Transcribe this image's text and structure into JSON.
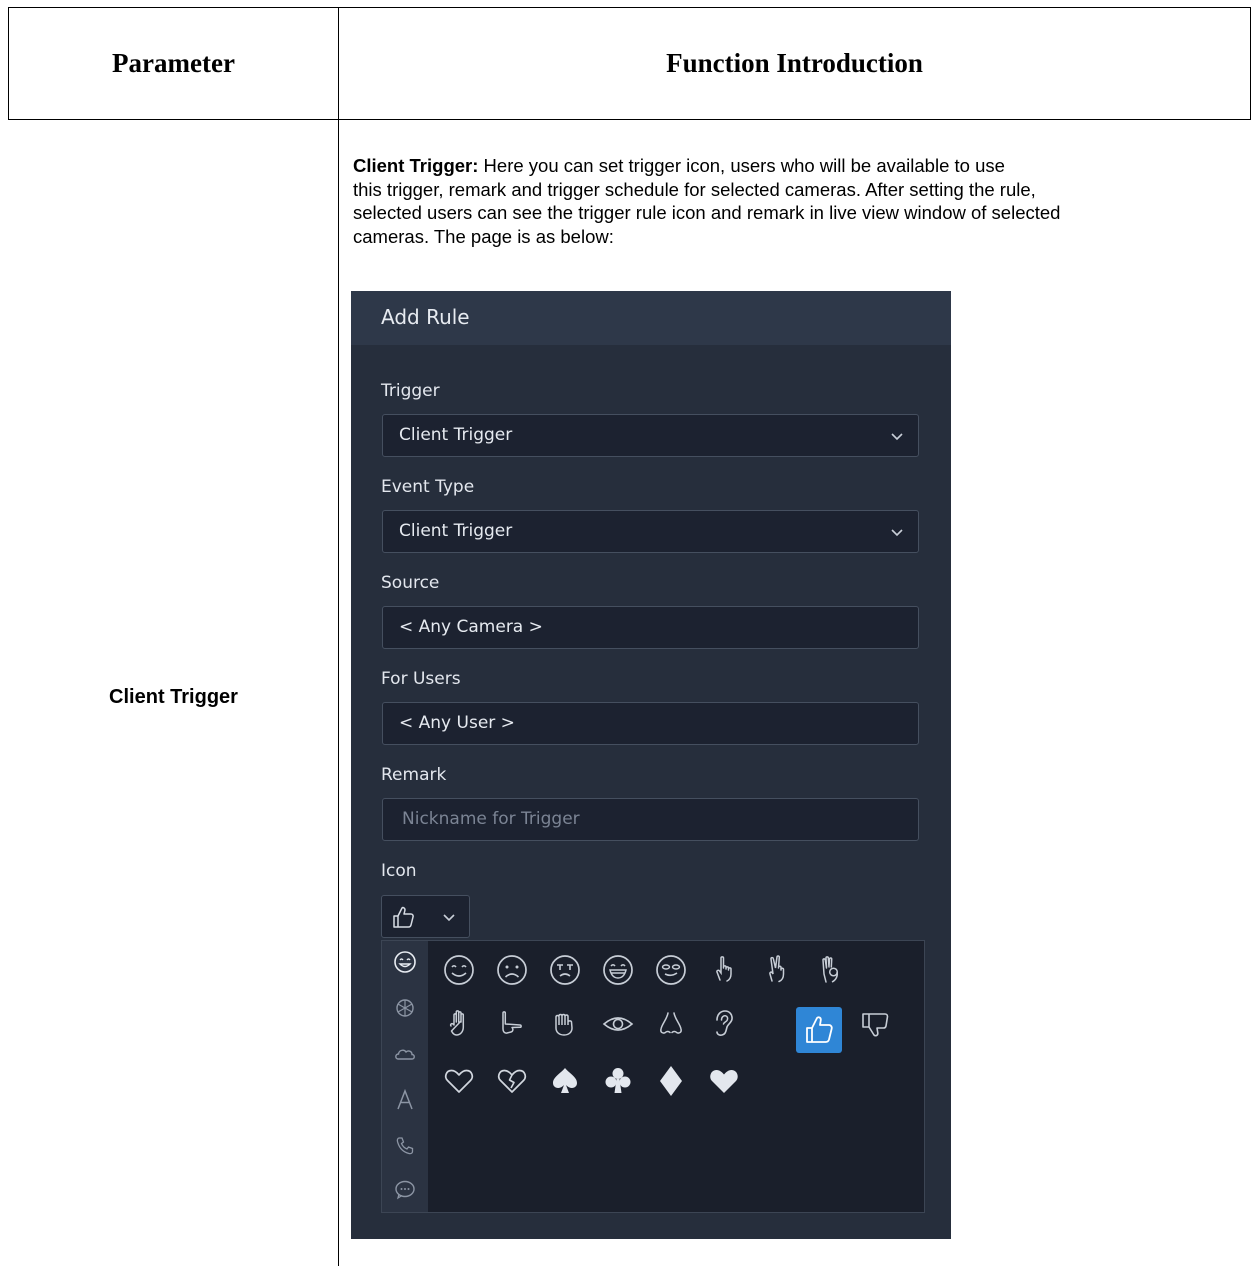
{
  "table": {
    "header_parameter": "Parameter",
    "header_function": "Function Introduction",
    "row_parameter": "Client Trigger"
  },
  "intro": {
    "lead": "Client Trigger:",
    "line1": " Here you can set trigger icon, users who will be available to use",
    "line2": "this trigger, remark and trigger schedule for selected cameras. After setting the rule,",
    "line3": "selected users can see the trigger rule icon and remark in live view window of selected",
    "line4": "cameras. The page is as below:"
  },
  "dialog": {
    "title": "Add Rule",
    "trigger_label": "Trigger",
    "trigger_value": "Client Trigger",
    "event_type_label": "Event Type",
    "event_type_value": "Client Trigger",
    "source_label": "Source",
    "source_value": "< Any Camera >",
    "for_users_label": "For Users",
    "for_users_value": "< Any User >",
    "remark_label": "Remark",
    "remark_placeholder": "Nickname for Trigger",
    "icon_label": "Icon",
    "icon_selected": "thumbs-up-icon",
    "categories": [
      "smiley-icon",
      "recycle-icon",
      "cloud-icon",
      "letter-a-icon",
      "phone-icon",
      "chat-bubble-icon"
    ],
    "icon_grid": [
      [
        "smile-icon",
        "frown-icon",
        "crying-icon",
        "laughing-icon",
        "smirk-icon",
        "pointing-finger-icon",
        "victory-hand-icon",
        "ok-hand-icon"
      ],
      [
        "raised-hand-icon",
        "hand-point-icon",
        "fist-icon",
        "eye-icon",
        "nose-icon",
        "ear-icon",
        "thumbs-up-icon",
        "thumbs-down-icon"
      ],
      [
        "heart-outline-icon",
        "broken-heart-icon",
        "spade-icon",
        "club-icon",
        "diamond-icon",
        "heart-filled-icon"
      ]
    ],
    "colors": {
      "background": "#262e3c",
      "header": "#2e3849",
      "field": "#1c2230",
      "accent": "#2f86d6"
    }
  }
}
